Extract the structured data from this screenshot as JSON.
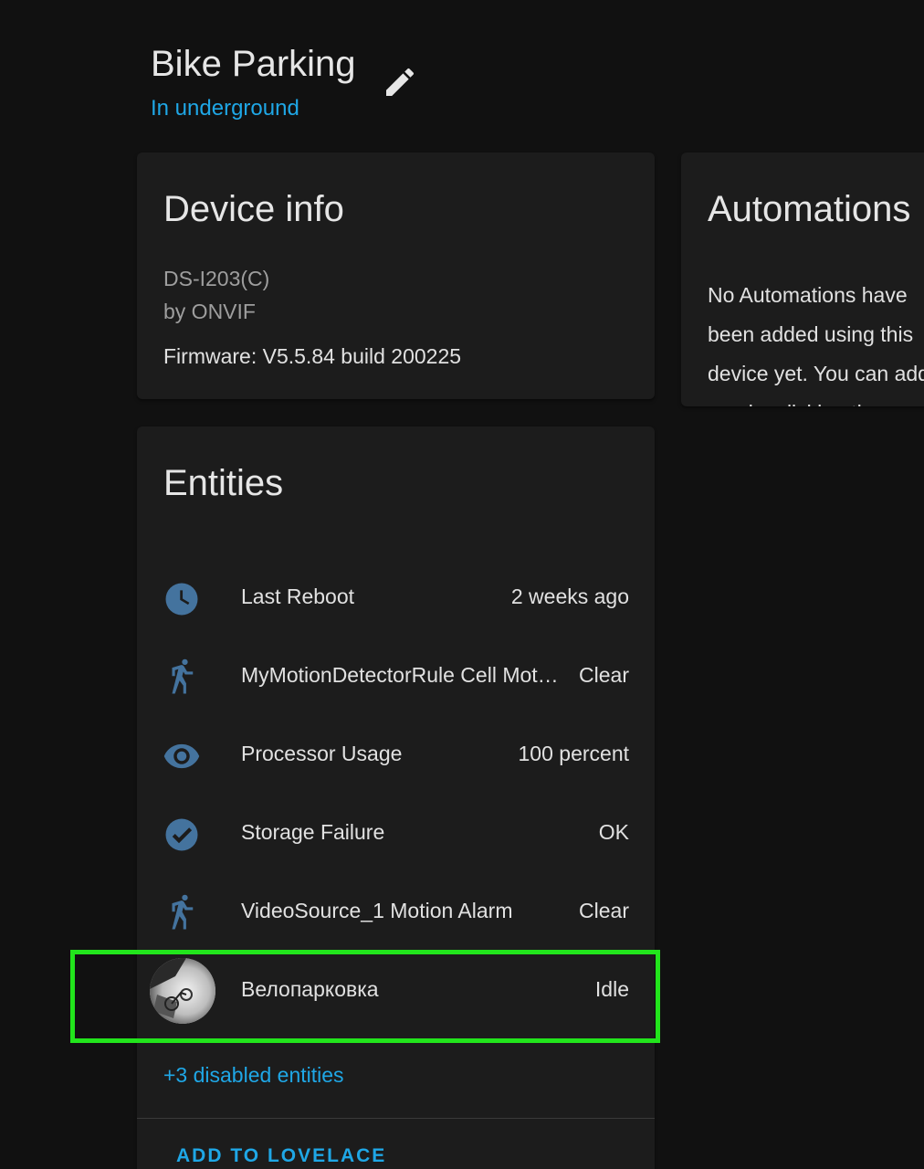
{
  "header": {
    "title": "Bike Parking",
    "area": "In underground"
  },
  "device_info": {
    "heading": "Device info",
    "model": "DS-I203(C)",
    "manufacturer": "by ONVIF",
    "firmware": "Firmware: V5.5.84 build 200225"
  },
  "automations": {
    "heading": "Automations",
    "empty_text": "No Automations have been added using this device yet. You can add one by clicking the + button above."
  },
  "entities": {
    "heading": "Entities",
    "items": [
      {
        "name": "Last Reboot",
        "state": "2 weeks ago",
        "icon": "clock-icon"
      },
      {
        "name": "MyMotionDetectorRule Cell Motion Detection",
        "state": "Clear",
        "icon": "walk-icon"
      },
      {
        "name": "Processor Usage",
        "state": "100 percent",
        "icon": "eye-icon"
      },
      {
        "name": "Storage Failure",
        "state": "OK",
        "icon": "check-circle-icon"
      },
      {
        "name": "VideoSource_1 Motion Alarm",
        "state": "Clear",
        "icon": "walk-icon"
      },
      {
        "name": "Велопарковка",
        "state": "Idle",
        "icon": "camera-thumbnail"
      }
    ],
    "disabled_link": "+3 disabled entities",
    "add_button": "ADD TO LOVELACE"
  },
  "colors": {
    "accent": "#1fa7e6",
    "icon": "#44739e",
    "highlight": "#22e51c",
    "card": "#1c1c1c",
    "background": "#111111"
  }
}
